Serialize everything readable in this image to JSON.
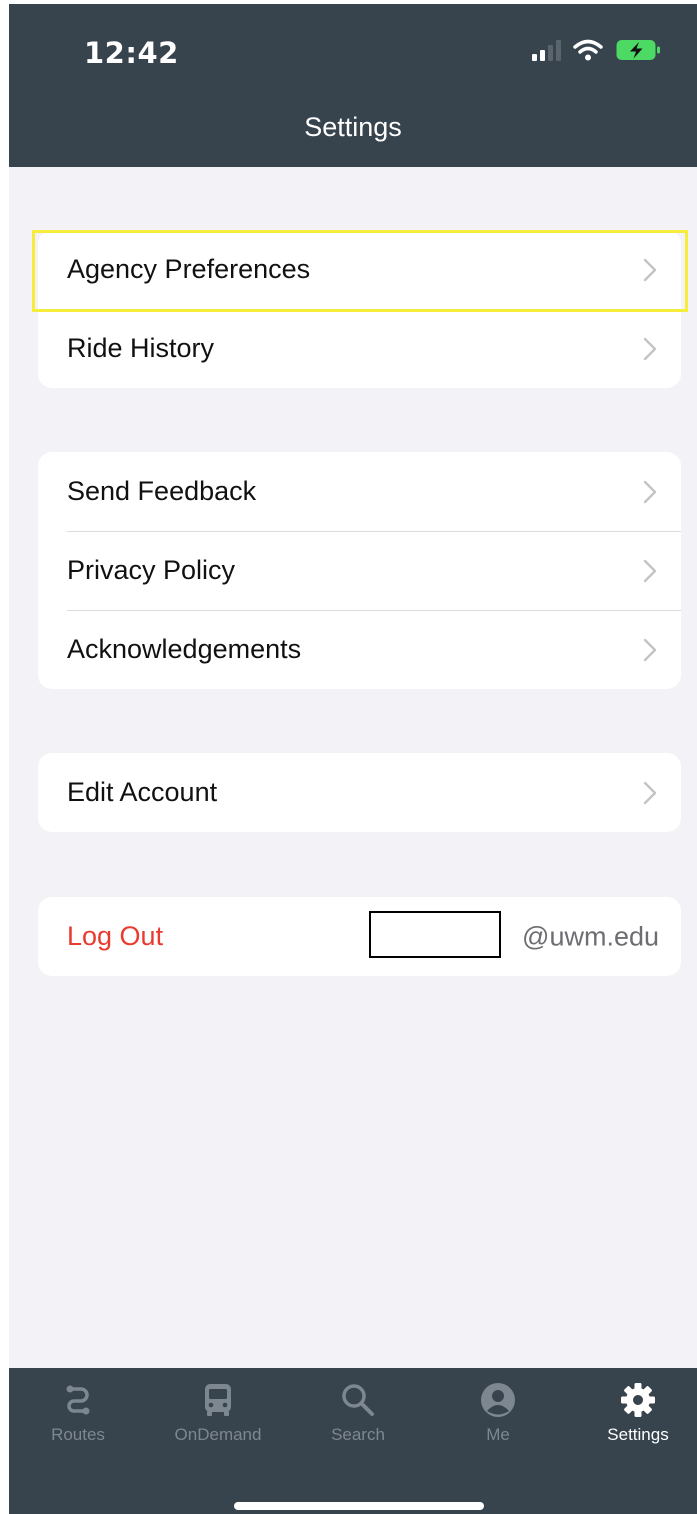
{
  "status_bar": {
    "time": "12:42"
  },
  "header": {
    "title": "Settings"
  },
  "groups": {
    "account": {
      "agency_preferences": "Agency Preferences",
      "ride_history": "Ride History"
    },
    "info": {
      "send_feedback": "Send Feedback",
      "privacy_policy": "Privacy Policy",
      "acknowledgements": "Acknowledgements"
    },
    "edit": {
      "edit_account": "Edit Account"
    },
    "session": {
      "log_out": "Log Out",
      "email_suffix": "@uwm.edu"
    }
  },
  "tabs": {
    "routes": "Routes",
    "ondemand": "OnDemand",
    "search": "Search",
    "me": "Me",
    "settings": "Settings"
  },
  "colors": {
    "header_bg": "#37434d",
    "page_bg": "#f2f2f7",
    "destructive": "#ea3a2f",
    "highlight": "#f5ec3c",
    "battery": "#4cd964",
    "tab_inactive": "#7d8790",
    "tab_active": "#ffffff"
  },
  "icons": {
    "signal": "cellular-signal-icon",
    "wifi": "wifi-icon",
    "battery": "battery-charging-icon",
    "chevron": "chevron-right-icon",
    "routes": "route-icon",
    "ondemand": "bus-icon",
    "search": "search-icon",
    "me": "user-circle-icon",
    "settings": "gear-icon"
  }
}
